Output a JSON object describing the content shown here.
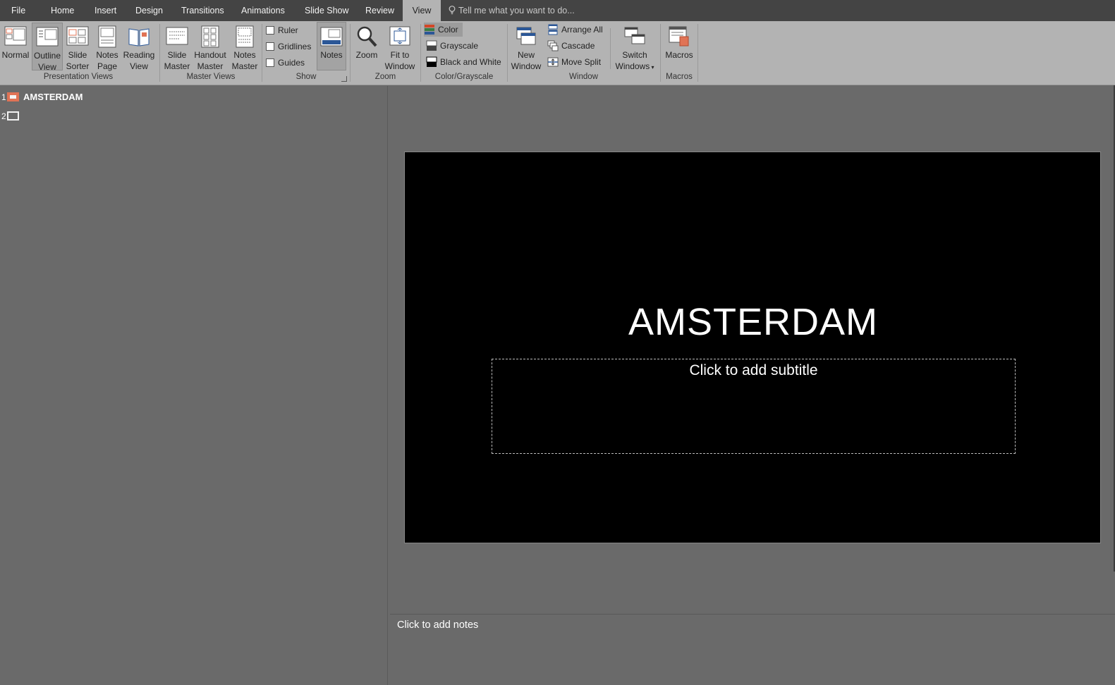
{
  "tabs": [
    {
      "label": "File"
    },
    {
      "label": "Home"
    },
    {
      "label": "Insert"
    },
    {
      "label": "Design"
    },
    {
      "label": "Transitions"
    },
    {
      "label": "Animations"
    },
    {
      "label": "Slide Show"
    },
    {
      "label": "Review"
    },
    {
      "label": "View"
    }
  ],
  "active_tab": "View",
  "tell_me": "Tell me what you want to do...",
  "ribbon": {
    "presentation_views": {
      "label": "Presentation Views",
      "normal": "Normal",
      "outline_l1": "Outline",
      "outline_l2": "View",
      "sorter_l1": "Slide",
      "sorter_l2": "Sorter",
      "notes_l1": "Notes",
      "notes_l2": "Page",
      "reading_l1": "Reading",
      "reading_l2": "View"
    },
    "master_views": {
      "label": "Master Views",
      "slide_l1": "Slide",
      "slide_l2": "Master",
      "handout_l1": "Handout",
      "handout_l2": "Master",
      "notes_l1": "Notes",
      "notes_l2": "Master"
    },
    "show": {
      "label": "Show",
      "ruler": "Ruler",
      "gridlines": "Gridlines",
      "guides": "Guides",
      "notes": "Notes"
    },
    "zoom": {
      "label": "Zoom",
      "zoom": "Zoom",
      "fit_l1": "Fit to",
      "fit_l2": "Window"
    },
    "color": {
      "label": "Color/Grayscale",
      "color": "Color",
      "grayscale": "Grayscale",
      "bw": "Black and White"
    },
    "window": {
      "label": "Window",
      "new_l1": "New",
      "new_l2": "Window",
      "arrange": "Arrange All",
      "cascade": "Cascade",
      "move_split": "Move Split",
      "switch_l1": "Switch",
      "switch_l2": "Windows"
    },
    "macros": {
      "label": "Macros",
      "macros": "Macros"
    }
  },
  "outline": {
    "slides": [
      {
        "num": "1",
        "title": "AMSTERDAM"
      },
      {
        "num": "2",
        "title": ""
      }
    ]
  },
  "slide": {
    "title": "AMSTERDAM",
    "subtitle_placeholder": "Click to add subtitle"
  },
  "notes": {
    "placeholder": "Click to add notes"
  }
}
